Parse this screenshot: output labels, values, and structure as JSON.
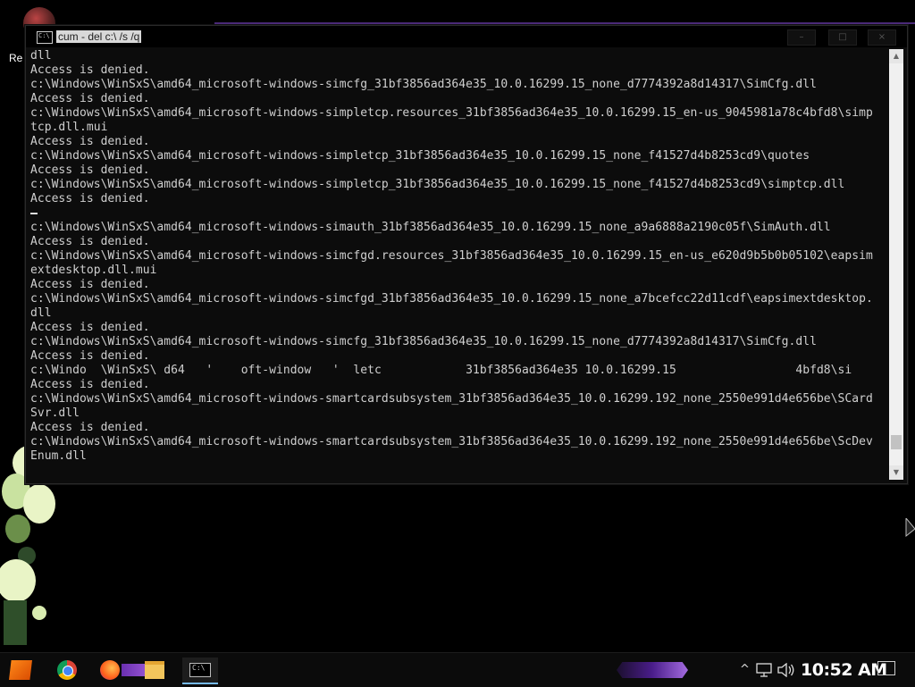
{
  "desktop": {
    "icon_label": "Re"
  },
  "window": {
    "title": "cum - del c:\\ /s /q",
    "buttons": {
      "minimize": "–",
      "maximize": "□",
      "close": "×"
    }
  },
  "console": {
    "lines": [
      "dll",
      "Access is denied.",
      "c:\\Windows\\WinSxS\\amd64_microsoft-windows-simcfg_31bf3856ad364e35_10.0.16299.15_none_d7774392a8d14317\\SimCfg.dll",
      "Access is denied.",
      "c:\\Windows\\WinSxS\\amd64_microsoft-windows-simpletcp.resources_31bf3856ad364e35_10.0.16299.15_en-us_9045981a78c4bfd8\\simp",
      "tcp.dll.mui",
      "Access is denied.",
      "c:\\Windows\\WinSxS\\amd64_microsoft-windows-simpletcp_31bf3856ad364e35_10.0.16299.15_none_f41527d4b8253cd9\\quotes",
      "Access is denied.",
      "c:\\Windows\\WinSxS\\amd64_microsoft-windows-simpletcp_31bf3856ad364e35_10.0.16299.15_none_f41527d4b8253cd9\\simptcp.dll",
      "Access is denied.",
      "",
      "c:\\Windows\\WinSxS\\amd64_microsoft-windows-simauth_31bf3856ad364e35_10.0.16299.15_none_a9a6888a2190c05f\\SimAuth.dll",
      "Access is denied.",
      "c:\\Windows\\WinSxS\\amd64_microsoft-windows-simcfgd.resources_31bf3856ad364e35_10.0.16299.15_en-us_e620d9b5b0b05102\\eapsim",
      "extdesktop.dll.mui",
      "Access is denied.",
      "c:\\Windows\\WinSxS\\amd64_microsoft-windows-simcfgd_31bf3856ad364e35_10.0.16299.15_none_a7bcefcc22d11cdf\\eapsimextdesktop.",
      "dll",
      "Access is denied.",
      "c:\\Windows\\WinSxS\\amd64_microsoft-windows-simcfg_31bf3856ad364e35_10.0.16299.15_none_d7774392a8d14317\\SimCfg.dll",
      "Access is denied.",
      "c:\\Windo  \\WinSxS\\ d64   '    oft-window   '  letc            31bf3856ad364e35 10.0.16299.15                 4bfd8\\si",
      "Access is denied.",
      "c:\\Windows\\WinSxS\\amd64_microsoft-windows-smartcardsubsystem_31bf3856ad364e35_10.0.16299.192_none_2550e991d4e656be\\SCard",
      "Svr.dll",
      "Access is denied.",
      "c:\\Windows\\WinSxS\\amd64_microsoft-windows-smartcardsubsystem_31bf3856ad364e35_10.0.16299.192_none_2550e991d4e656be\\ScDev",
      "Enum.dll"
    ]
  },
  "taskbar": {
    "apps": [
      "start-icon",
      "chrome-icon",
      "firefox-icon",
      "file-explorer-icon",
      "command-prompt-icon"
    ],
    "tray": {
      "chevron": "^",
      "clock": "10:52 AM"
    }
  }
}
